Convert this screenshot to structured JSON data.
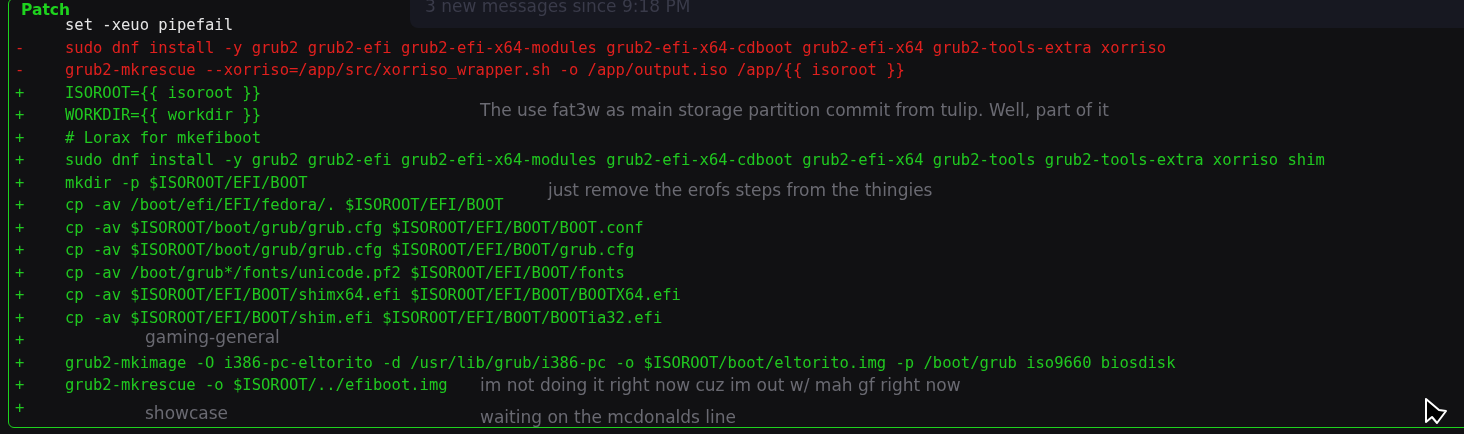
{
  "background_chat": {
    "banner": "3 new messages since 9:18 PM",
    "channels": [
      {
        "name": "gaming-general"
      },
      {
        "name": "showcase"
      }
    ],
    "messages": [
      {
        "text": "The use fat3w as main storage partition commit from tulip. Well, part of it"
      },
      {
        "text": "just remove the erofs steps from the thingies"
      },
      {
        "text": "im not doing it right now cuz im out w/ mah gf right now"
      },
      {
        "text": "waiting on the mcdonalds line"
      }
    ]
  },
  "patch": {
    "title": "Patch",
    "lines": [
      {
        "kind": "context",
        "text": "set -xeuo pipefail"
      },
      {
        "kind": "removed",
        "marker": "-",
        "text": "sudo dnf install -y grub2 grub2-efi grub2-efi-x64-modules grub2-efi-x64-cdboot grub2-efi-x64 grub2-tools-extra xorriso"
      },
      {
        "kind": "removed",
        "marker": "-",
        "text": "grub2-mkrescue --xorriso=/app/src/xorriso_wrapper.sh -o /app/output.iso /app/{{ isoroot }}"
      },
      {
        "kind": "added",
        "marker": "+",
        "text": "ISOROOT={{ isoroot }}"
      },
      {
        "kind": "added",
        "marker": "+",
        "text": "WORKDIR={{ workdir }}"
      },
      {
        "kind": "added",
        "marker": "+",
        "text": "# Lorax for mkefiboot"
      },
      {
        "kind": "added",
        "marker": "+",
        "text": "sudo dnf install -y grub2 grub2-efi grub2-efi-x64-modules grub2-efi-x64-cdboot grub2-efi-x64 grub2-tools grub2-tools-extra xorriso shim"
      },
      {
        "kind": "added",
        "marker": "+",
        "text": "mkdir -p $ISOROOT/EFI/BOOT"
      },
      {
        "kind": "added",
        "marker": "+",
        "text": "cp -av /boot/efi/EFI/fedora/. $ISOROOT/EFI/BOOT"
      },
      {
        "kind": "added",
        "marker": "+",
        "text": "cp -av $ISOROOT/boot/grub/grub.cfg $ISOROOT/EFI/BOOT/BOOT.conf"
      },
      {
        "kind": "added",
        "marker": "+",
        "text": "cp -av $ISOROOT/boot/grub/grub.cfg $ISOROOT/EFI/BOOT/grub.cfg"
      },
      {
        "kind": "added",
        "marker": "+",
        "text": "cp -av /boot/grub*/fonts/unicode.pf2 $ISOROOT/EFI/BOOT/fonts"
      },
      {
        "kind": "added",
        "marker": "+",
        "text": "cp -av $ISOROOT/EFI/BOOT/shimx64.efi $ISOROOT/EFI/BOOT/BOOTX64.efi"
      },
      {
        "kind": "added",
        "marker": "+",
        "text": "cp -av $ISOROOT/EFI/BOOT/shim.efi $ISOROOT/EFI/BOOT/BOOTia32.efi"
      },
      {
        "kind": "added",
        "marker": "+"
      },
      {
        "kind": "added",
        "marker": "+",
        "text": "grub2-mkimage -O i386-pc-eltorito -d /usr/lib/grub/i386-pc -o $ISOROOT/boot/eltorito.img -p /boot/grub iso9660 biosdisk"
      },
      {
        "kind": "added",
        "marker": "+",
        "text": "grub2-mkrescue -o $ISOROOT/../efiboot.img"
      },
      {
        "kind": "added",
        "marker": "+"
      }
    ]
  }
}
